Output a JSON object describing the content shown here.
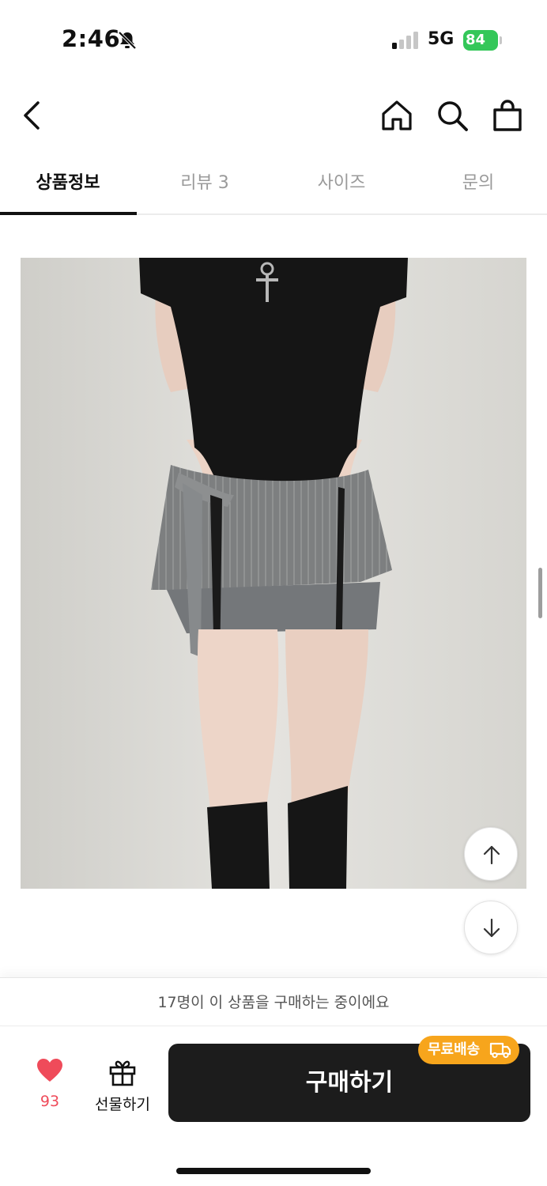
{
  "status_bar": {
    "time": "2:46",
    "network": "5G",
    "battery": "84"
  },
  "nav": {
    "icons": [
      "chevron-left-icon",
      "home-icon",
      "search-icon",
      "shopping-bag-icon"
    ]
  },
  "tabs": [
    {
      "label": "상품정보",
      "active": true
    },
    {
      "label": "리뷰 3",
      "active": false
    },
    {
      "label": "사이즈",
      "active": false
    },
    {
      "label": "문의",
      "active": false
    }
  ],
  "product": {
    "image": "product-photo"
  },
  "banner": {
    "text": "17명이 이 상품을 구매하는 중이에요"
  },
  "bottom_bar": {
    "like_count": "93",
    "gift_label": "선물하기",
    "buy_label": "구매하기",
    "free_shipping_label": "무료배송"
  },
  "colors": {
    "accent_orange": "#f7a51c",
    "like_red": "#ef4b5a",
    "battery_green": "#34c759",
    "buy_button": "#1c1c1c"
  }
}
